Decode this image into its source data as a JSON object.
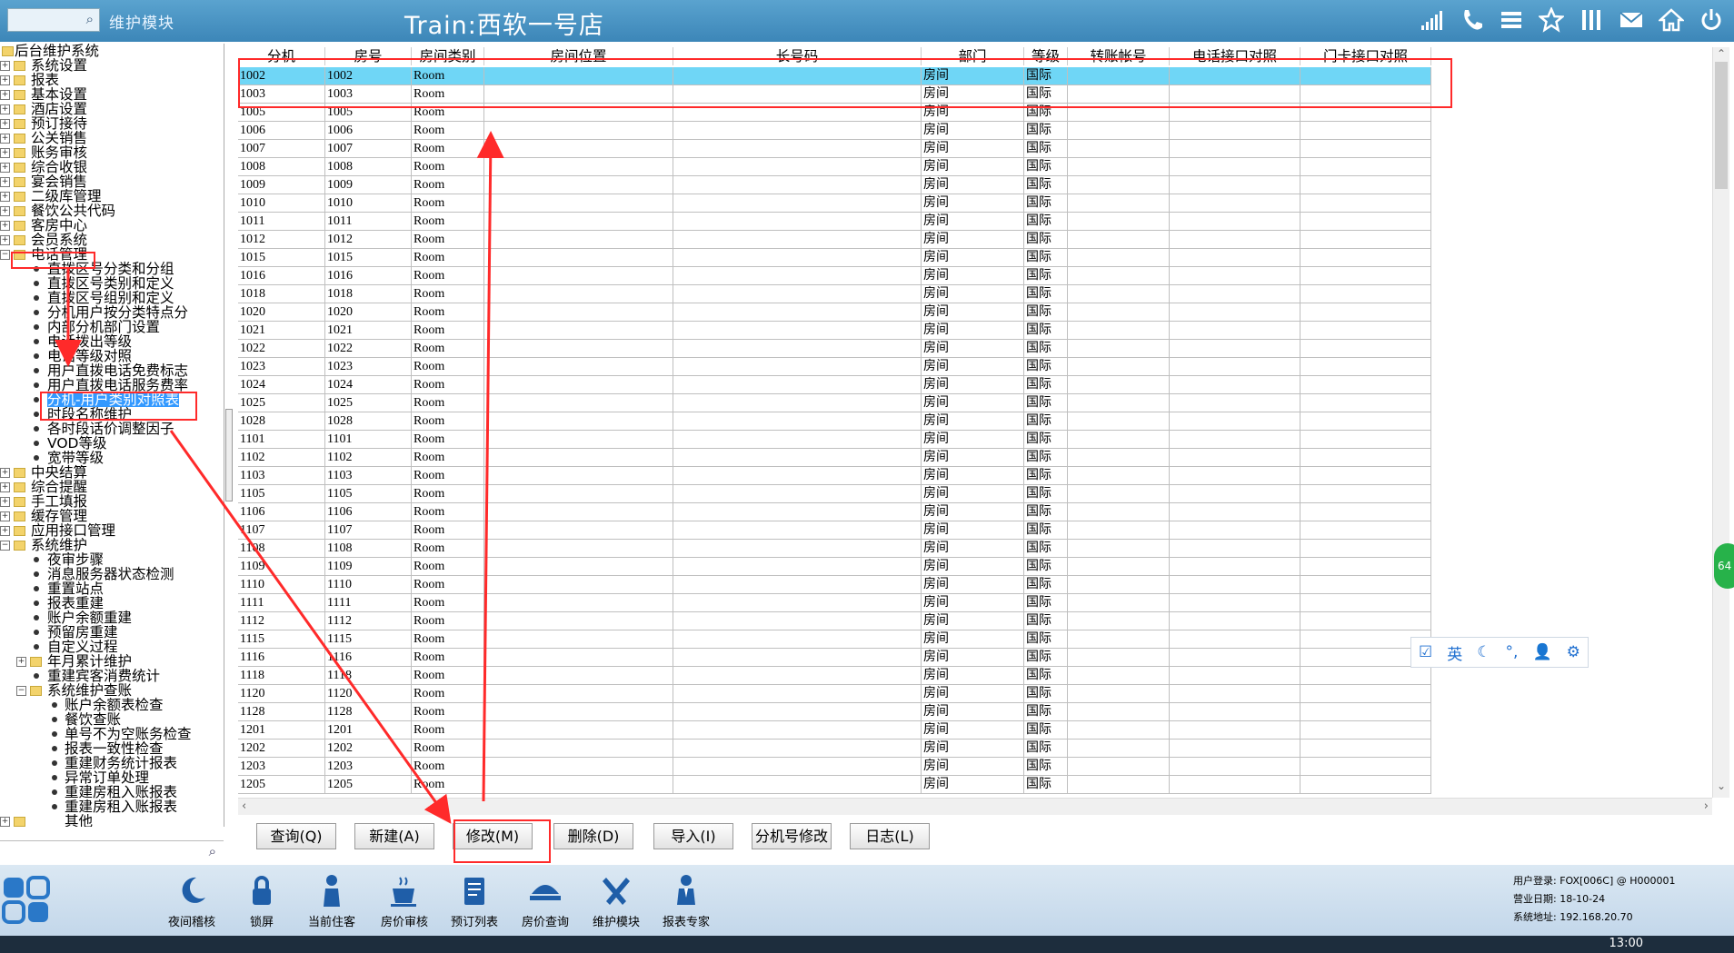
{
  "title_bar": {
    "module_name": "维护模块",
    "window_title": "Train:西软一号店",
    "icons": [
      "signal-icon",
      "phone-icon",
      "menu-icon",
      "star-icon",
      "columns-icon",
      "mail-icon",
      "home-icon",
      "power-icon"
    ]
  },
  "tree": {
    "items": [
      {
        "label": "后台维护系统",
        "level": 0,
        "type": "root"
      },
      {
        "label": "系统设置",
        "level": 1,
        "type": "folder"
      },
      {
        "label": "报表",
        "level": 1,
        "type": "folder"
      },
      {
        "label": "基本设置",
        "level": 1,
        "type": "folder"
      },
      {
        "label": "酒店设置",
        "level": 1,
        "type": "folder"
      },
      {
        "label": "预订接待",
        "level": 1,
        "type": "folder"
      },
      {
        "label": "公关销售",
        "level": 1,
        "type": "folder"
      },
      {
        "label": "账务审核",
        "level": 1,
        "type": "folder"
      },
      {
        "label": "综合收银",
        "level": 1,
        "type": "folder"
      },
      {
        "label": "宴会销售",
        "level": 1,
        "type": "folder"
      },
      {
        "label": "二级库管理",
        "level": 1,
        "type": "folder"
      },
      {
        "label": "餐饮公共代码",
        "level": 1,
        "type": "folder"
      },
      {
        "label": "客房中心",
        "level": 1,
        "type": "folder"
      },
      {
        "label": "会员系统",
        "level": 1,
        "type": "folder"
      },
      {
        "label": "电话管理",
        "level": 1,
        "type": "folder-open"
      },
      {
        "label": "直拨区号分类和分组",
        "level": 2,
        "type": "leaf"
      },
      {
        "label": "直拨区号类别和定义",
        "level": 2,
        "type": "leaf"
      },
      {
        "label": "直拨区号组别和定义",
        "level": 2,
        "type": "leaf"
      },
      {
        "label": "分机用户按分类特点分",
        "level": 2,
        "type": "leaf"
      },
      {
        "label": "内部分机部门设置",
        "level": 2,
        "type": "leaf"
      },
      {
        "label": "电话拨出等级",
        "level": 2,
        "type": "leaf"
      },
      {
        "label": "电话等级对照",
        "level": 2,
        "type": "leaf"
      },
      {
        "label": "用户直拨电话免费标志",
        "level": 2,
        "type": "leaf"
      },
      {
        "label": "用户直拨电话服务费率",
        "level": 2,
        "type": "leaf"
      },
      {
        "label": "分机-用户类别对照表",
        "level": 2,
        "type": "leaf",
        "selected": true
      },
      {
        "label": "时段名称维护",
        "level": 2,
        "type": "leaf"
      },
      {
        "label": "各时段话价调整因子",
        "level": 2,
        "type": "leaf"
      },
      {
        "label": "VOD等级",
        "level": 2,
        "type": "leaf"
      },
      {
        "label": "宽带等级",
        "level": 2,
        "type": "leaf"
      },
      {
        "label": "中央结算",
        "level": 1,
        "type": "folder"
      },
      {
        "label": "综合提醒",
        "level": 1,
        "type": "folder"
      },
      {
        "label": "手工填报",
        "level": 1,
        "type": "folder"
      },
      {
        "label": "缓存管理",
        "level": 1,
        "type": "folder"
      },
      {
        "label": "应用接口管理",
        "level": 1,
        "type": "folder"
      },
      {
        "label": "系统维护",
        "level": 1,
        "type": "folder-open"
      },
      {
        "label": "夜审步骤",
        "level": 2,
        "type": "leaf"
      },
      {
        "label": "消息服务器状态检测",
        "level": 2,
        "type": "leaf"
      },
      {
        "label": "重置站点",
        "level": 2,
        "type": "leaf"
      },
      {
        "label": "报表重建",
        "level": 2,
        "type": "leaf"
      },
      {
        "label": "账户余额重建",
        "level": 2,
        "type": "leaf"
      },
      {
        "label": "预留房重建",
        "level": 2,
        "type": "leaf"
      },
      {
        "label": "自定义过程",
        "level": 2,
        "type": "leaf"
      },
      {
        "label": "年月累计维护",
        "level": 2,
        "type": "folder"
      },
      {
        "label": "重建宾客消费统计",
        "level": 2,
        "type": "leaf"
      },
      {
        "label": "系统维护查账",
        "level": 2,
        "type": "folder-open"
      },
      {
        "label": "账户余额表检查",
        "level": 3,
        "type": "leaf"
      },
      {
        "label": "餐饮查账",
        "level": 3,
        "type": "leaf"
      },
      {
        "label": "单号不为空账务检查",
        "level": 3,
        "type": "leaf"
      },
      {
        "label": "报表一致性检查",
        "level": 3,
        "type": "leaf"
      },
      {
        "label": "重建财务统计报表",
        "level": 3,
        "type": "leaf"
      },
      {
        "label": "异常订单处理",
        "level": 3,
        "type": "leaf"
      },
      {
        "label": "重建房租入账报表",
        "level": 3,
        "type": "leaf"
      },
      {
        "label": "重建房租入账报表",
        "level": 3,
        "type": "leaf"
      },
      {
        "label": "其他",
        "level": 0,
        "type": "folder"
      }
    ]
  },
  "grid": {
    "columns": [
      "分机",
      "房号",
      "房间类别",
      "房间位置",
      "长号码",
      "部门",
      "等级",
      "转账帐号",
      "电话接口对照",
      "门卡接口对照"
    ],
    "rows": [
      [
        "1002",
        "1002",
        "Room",
        "",
        "",
        "房间",
        "国际",
        "",
        "",
        ""
      ],
      [
        "1003",
        "1003",
        "Room",
        "",
        "",
        "房间",
        "国际",
        "",
        "",
        ""
      ],
      [
        "1005",
        "1005",
        "Room",
        "",
        "",
        "房间",
        "国际",
        "",
        "",
        ""
      ],
      [
        "1006",
        "1006",
        "Room",
        "",
        "",
        "房间",
        "国际",
        "",
        "",
        ""
      ],
      [
        "1007",
        "1007",
        "Room",
        "",
        "",
        "房间",
        "国际",
        "",
        "",
        ""
      ],
      [
        "1008",
        "1008",
        "Room",
        "",
        "",
        "房间",
        "国际",
        "",
        "",
        ""
      ],
      [
        "1009",
        "1009",
        "Room",
        "",
        "",
        "房间",
        "国际",
        "",
        "",
        ""
      ],
      [
        "1010",
        "1010",
        "Room",
        "",
        "",
        "房间",
        "国际",
        "",
        "",
        ""
      ],
      [
        "1011",
        "1011",
        "Room",
        "",
        "",
        "房间",
        "国际",
        "",
        "",
        ""
      ],
      [
        "1012",
        "1012",
        "Room",
        "",
        "",
        "房间",
        "国际",
        "",
        "",
        ""
      ],
      [
        "1015",
        "1015",
        "Room",
        "",
        "",
        "房间",
        "国际",
        "",
        "",
        ""
      ],
      [
        "1016",
        "1016",
        "Room",
        "",
        "",
        "房间",
        "国际",
        "",
        "",
        ""
      ],
      [
        "1018",
        "1018",
        "Room",
        "",
        "",
        "房间",
        "国际",
        "",
        "",
        ""
      ],
      [
        "1020",
        "1020",
        "Room",
        "",
        "",
        "房间",
        "国际",
        "",
        "",
        ""
      ],
      [
        "1021",
        "1021",
        "Room",
        "",
        "",
        "房间",
        "国际",
        "",
        "",
        ""
      ],
      [
        "1022",
        "1022",
        "Room",
        "",
        "",
        "房间",
        "国际",
        "",
        "",
        ""
      ],
      [
        "1023",
        "1023",
        "Room",
        "",
        "",
        "房间",
        "国际",
        "",
        "",
        ""
      ],
      [
        "1024",
        "1024",
        "Room",
        "",
        "",
        "房间",
        "国际",
        "",
        "",
        ""
      ],
      [
        "1025",
        "1025",
        "Room",
        "",
        "",
        "房间",
        "国际",
        "",
        "",
        ""
      ],
      [
        "1028",
        "1028",
        "Room",
        "",
        "",
        "房间",
        "国际",
        "",
        "",
        ""
      ],
      [
        "1101",
        "1101",
        "Room",
        "",
        "",
        "房间",
        "国际",
        "",
        "",
        ""
      ],
      [
        "1102",
        "1102",
        "Room",
        "",
        "",
        "房间",
        "国际",
        "",
        "",
        ""
      ],
      [
        "1103",
        "1103",
        "Room",
        "",
        "",
        "房间",
        "国际",
        "",
        "",
        ""
      ],
      [
        "1105",
        "1105",
        "Room",
        "",
        "",
        "房间",
        "国际",
        "",
        "",
        ""
      ],
      [
        "1106",
        "1106",
        "Room",
        "",
        "",
        "房间",
        "国际",
        "",
        "",
        ""
      ],
      [
        "1107",
        "1107",
        "Room",
        "",
        "",
        "房间",
        "国际",
        "",
        "",
        ""
      ],
      [
        "1108",
        "1108",
        "Room",
        "",
        "",
        "房间",
        "国际",
        "",
        "",
        ""
      ],
      [
        "1109",
        "1109",
        "Room",
        "",
        "",
        "房间",
        "国际",
        "",
        "",
        ""
      ],
      [
        "1110",
        "1110",
        "Room",
        "",
        "",
        "房间",
        "国际",
        "",
        "",
        ""
      ],
      [
        "1111",
        "1111",
        "Room",
        "",
        "",
        "房间",
        "国际",
        "",
        "",
        ""
      ],
      [
        "1112",
        "1112",
        "Room",
        "",
        "",
        "房间",
        "国际",
        "",
        "",
        ""
      ],
      [
        "1115",
        "1115",
        "Room",
        "",
        "",
        "房间",
        "国际",
        "",
        "",
        ""
      ],
      [
        "1116",
        "1116",
        "Room",
        "",
        "",
        "房间",
        "国际",
        "",
        "",
        ""
      ],
      [
        "1118",
        "1118",
        "Room",
        "",
        "",
        "房间",
        "国际",
        "",
        "",
        ""
      ],
      [
        "1120",
        "1120",
        "Room",
        "",
        "",
        "房间",
        "国际",
        "",
        "",
        ""
      ],
      [
        "1128",
        "1128",
        "Room",
        "",
        "",
        "房间",
        "国际",
        "",
        "",
        ""
      ],
      [
        "1201",
        "1201",
        "Room",
        "",
        "",
        "房间",
        "国际",
        "",
        "",
        ""
      ],
      [
        "1202",
        "1202",
        "Room",
        "",
        "",
        "房间",
        "国际",
        "",
        "",
        ""
      ],
      [
        "1203",
        "1203",
        "Room",
        "",
        "",
        "房间",
        "国际",
        "",
        "",
        ""
      ],
      [
        "1205",
        "1205",
        "Room",
        "",
        "",
        "房间",
        "国际",
        "",
        "",
        ""
      ]
    ],
    "selected_row": 0
  },
  "buttons": [
    "查询(Q)",
    "新建(A)",
    "修改(M)",
    "删除(D)",
    "导入(I)",
    "分机号修改",
    "日志(L)"
  ],
  "dock": [
    {
      "label": "夜间稽核",
      "icon": "moon-icon"
    },
    {
      "label": "锁屏",
      "icon": "lock-icon"
    },
    {
      "label": "当前住客",
      "icon": "person-icon"
    },
    {
      "label": "房价审核",
      "icon": "cup-icon"
    },
    {
      "label": "预订列表",
      "icon": "clipboard-icon"
    },
    {
      "label": "房价查询",
      "icon": "hat-icon"
    },
    {
      "label": "维护模块",
      "icon": "tools-icon"
    },
    {
      "label": "报表专家",
      "icon": "expert-icon"
    }
  ],
  "status": {
    "user_login": "用户登录: FOX[006C] @ H000001",
    "business_date": "营业日期: 18-10-24",
    "system_address": "系统地址: 192.168.20.70"
  },
  "ime": {
    "lang": "英"
  },
  "badge": {
    "text": "64"
  },
  "taskbar": {
    "time": "13:00"
  },
  "colors": {
    "titlebar": "#3f8bbd",
    "selected_row": "#6fd6f6",
    "annotation": "#ff2a2a",
    "tree_selected": "#3399ff"
  }
}
